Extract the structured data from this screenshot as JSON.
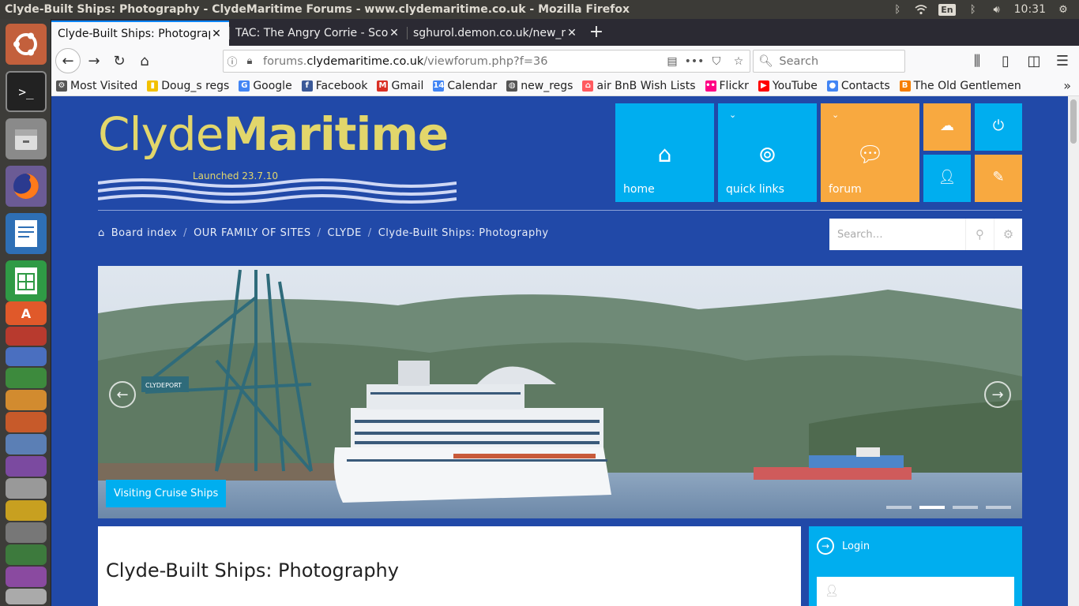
{
  "window": {
    "title": "Clyde-Built Ships: Photography - ClydeMaritime Forums - www.clydemaritime.co.uk - Mozilla Firefox",
    "keyboard": "En",
    "time": "10:31"
  },
  "tabs": [
    {
      "label": "Clyde-Built Ships: Photograp",
      "active": true
    },
    {
      "label": "TAC: The Angry Corrie - Scoti",
      "active": false
    },
    {
      "label": "sghurol.demon.co.uk/new_r",
      "active": false
    }
  ],
  "url": {
    "prefix": "forums.",
    "domain": "clydemaritime.co.uk",
    "path": "/viewforum.php?f=36"
  },
  "search_placeholder": "Search",
  "bookmarks": [
    {
      "label": "Most Visited",
      "icon": "gear-icon",
      "color": "#555555"
    },
    {
      "label": "Doug_s regs",
      "icon": "bookmark-icon",
      "color": "#f2c000"
    },
    {
      "label": "Google",
      "icon": "google-icon",
      "color": "#4285f4"
    },
    {
      "label": "Facebook",
      "icon": "facebook-icon",
      "color": "#3b5998"
    },
    {
      "label": "Gmail",
      "icon": "gmail-icon",
      "color": "#d93025"
    },
    {
      "label": "Calendar",
      "icon": "calendar-icon",
      "color": "#4285f4"
    },
    {
      "label": "new_regs",
      "icon": "globe-icon",
      "color": "#555555"
    },
    {
      "label": "air BnB Wish Lists",
      "icon": "airbnb-icon",
      "color": "#ff5a5f"
    },
    {
      "label": "Flickr",
      "icon": "flickr-icon",
      "color": "#ff0084"
    },
    {
      "label": "YouTube",
      "icon": "youtube-icon",
      "color": "#ff0000"
    },
    {
      "label": "Contacts",
      "icon": "contacts-icon",
      "color": "#4285f4"
    },
    {
      "label": "The Old Gentlemen",
      "icon": "blogger-icon",
      "color": "#f57d00"
    }
  ],
  "site": {
    "logo_light": "Clyde",
    "logo_bold": "Maritime",
    "logo_sub": "Launched 23.7.10",
    "tiles": {
      "home": "home",
      "quick_links": "quick links",
      "forum": "forum"
    },
    "breadcrumb": [
      "Board index",
      "OUR FAMILY OF SITES",
      "CLYDE",
      "Clyde-Built Ships: Photography"
    ],
    "search_placeholder": "Search…",
    "hero_caption": "Visiting Cruise Ships",
    "hero_slide": {
      "total": 4,
      "active": 2
    },
    "forum_title": "Clyde-Built Ships: Photography",
    "login_label": "Login",
    "crane_label": "CLYDEPORT"
  },
  "colors": {
    "page_bg": "#2149a8",
    "tile_blue": "#00aeef",
    "tile_orange": "#f8a940",
    "logo_gold": "#e2d66b"
  }
}
